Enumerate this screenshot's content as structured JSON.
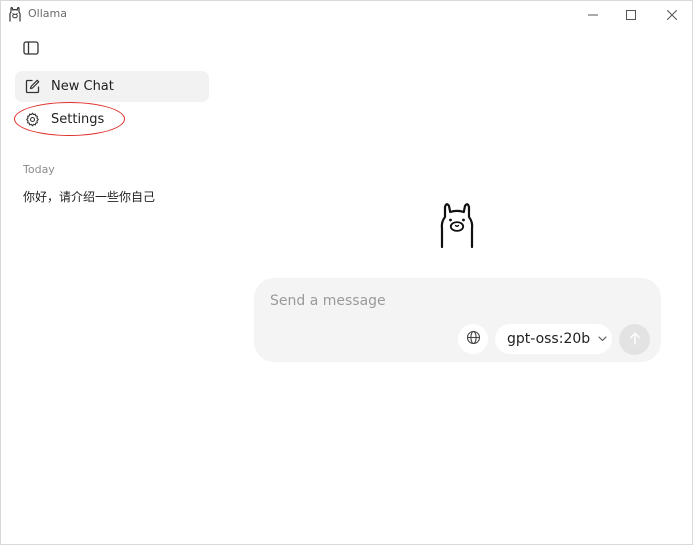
{
  "window": {
    "title": "Ollama",
    "icons": {
      "app": "llama-icon",
      "minimize": "minimize-icon",
      "maximize": "maximize-icon",
      "close": "close-icon"
    }
  },
  "sidebar": {
    "toggle_icon": "sidebar-toggle-icon",
    "nav": [
      {
        "label": "New Chat",
        "icon": "edit-icon",
        "active": true
      },
      {
        "label": "Settings",
        "icon": "gear-icon",
        "active": false
      }
    ],
    "history_section_label": "Today",
    "history": [
      {
        "title": "你好，请介绍一些你自己"
      }
    ]
  },
  "main": {
    "logo_icon": "llama-logo-icon",
    "composer": {
      "placeholder": "Send a message",
      "value": "",
      "web_search_icon": "globe-icon",
      "model": "gpt-oss:20b",
      "model_chevron_icon": "chevron-down-icon",
      "send_icon": "arrow-up-icon"
    }
  },
  "colors": {
    "accent_highlight": "#e0302a",
    "composer_bg": "#f4f4f4",
    "active_nav_bg": "#f2f2f2",
    "send_button_bg": "#e3e3e3"
  }
}
